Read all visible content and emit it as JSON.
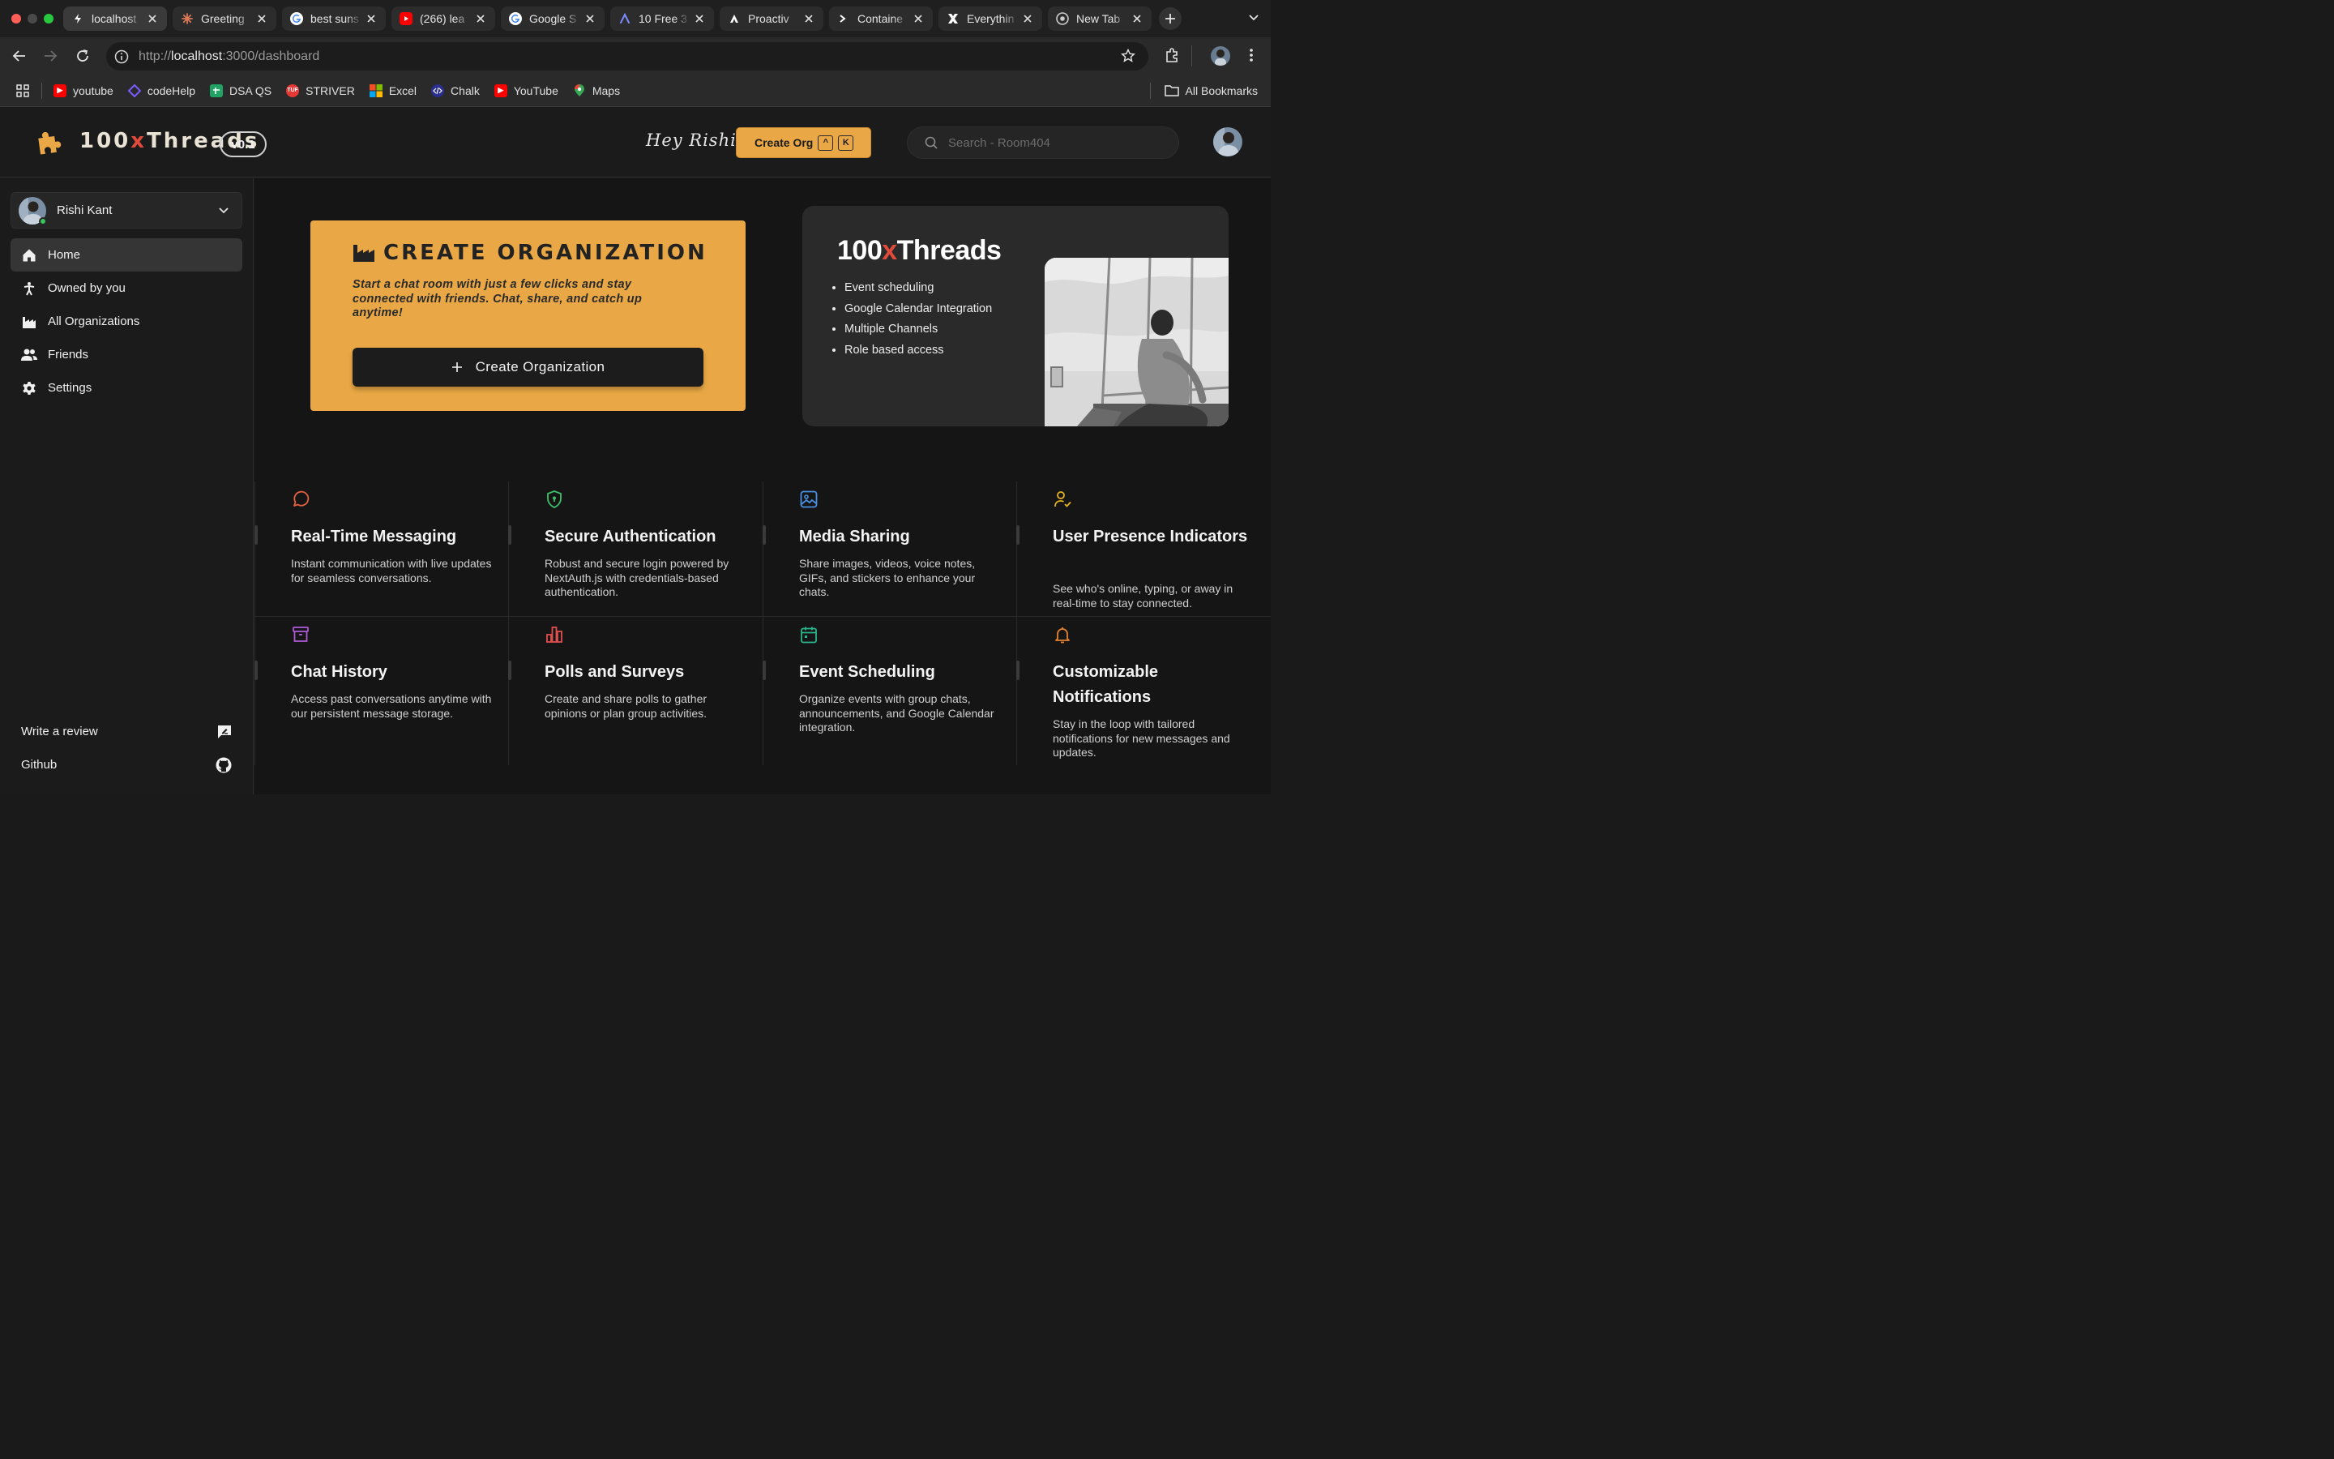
{
  "browser": {
    "tabs": [
      {
        "label": "localhost",
        "icon": "bolt-icon",
        "color": "#1f1f1f"
      },
      {
        "label": "Greeting",
        "icon": "claude-icon",
        "color": "#d97757"
      },
      {
        "label": "best suns",
        "icon": "google-icon",
        "color": "#ffffff"
      },
      {
        "label": "(266) lea",
        "icon": "youtube-icon",
        "color": "#ff0000"
      },
      {
        "label": "Google S",
        "icon": "google-icon",
        "color": "#ffffff"
      },
      {
        "label": "10 Free 3",
        "icon": "arc-icon",
        "color": "#5b6ee1"
      },
      {
        "label": "Proactiv",
        "icon": "vercel-icon",
        "color": "#111111"
      },
      {
        "label": "Containe",
        "icon": "terminal-icon",
        "color": "#111111"
      },
      {
        "label": "Everythin",
        "icon": "x-logo-icon",
        "color": "#222222"
      },
      {
        "label": "New Tab",
        "icon": "chrome-icon",
        "color": "#4a4a4a"
      }
    ],
    "url_scheme": "http://",
    "url_host": "localhost",
    "url_path": ":3000/dashboard",
    "bookmarks": [
      {
        "label": "youtube",
        "icon": "youtube-icon",
        "color": "#ff0000"
      },
      {
        "label": "codeHelp",
        "icon": "codehelp-icon",
        "color": "#7a5cff"
      },
      {
        "label": "DSA QS",
        "icon": "sheets-icon",
        "color": "#21a366"
      },
      {
        "label": "STRIVER",
        "icon": "tuf-icon",
        "color": "#e53935"
      },
      {
        "label": "Excel",
        "icon": "microsoft-icon",
        "color": "#f25022"
      },
      {
        "label": "Chalk",
        "icon": "chalk-icon",
        "color": "#2a2f8f"
      },
      {
        "label": "YouTube",
        "icon": "youtube-icon",
        "color": "#ff0000"
      },
      {
        "label": "Maps",
        "icon": "maps-pin-icon",
        "color": "#34a853"
      }
    ],
    "all_bookmarks_label": "All Bookmarks"
  },
  "header": {
    "brand_prefix": "100",
    "brand_x": "x",
    "brand_suffix": "Threads",
    "version": "v0.1",
    "greeting": "Hey Rishi",
    "create_org_label": "Create Org",
    "shortcut_keys": [
      "^",
      "K"
    ],
    "search_placeholder": "Search - Room404"
  },
  "sidebar": {
    "user_name": "Rishi Kant",
    "items": [
      {
        "label": "Home",
        "icon": "home-icon",
        "active": true
      },
      {
        "label": "Owned by you",
        "icon": "person-icon",
        "active": false
      },
      {
        "label": "All Organizations",
        "icon": "factory-icon",
        "active": false
      },
      {
        "label": "Friends",
        "icon": "people-icon",
        "active": false
      },
      {
        "label": "Settings",
        "icon": "gear-icon",
        "active": false
      }
    ],
    "write_review": "Write a review",
    "github": "Github"
  },
  "org_card": {
    "title": "CREATE ORGANIZATION",
    "description": "Start a chat room with just a few clicks and stay connected with friends. Chat, share, and catch up anytime!",
    "button_label": "Create Organization",
    "background": "#e9a845"
  },
  "promo": {
    "title_prefix": "100",
    "title_x": "x",
    "title_suffix": "Threads",
    "features": [
      "Event scheduling",
      "Google Calendar Integration",
      "Multiple Channels",
      "Role based access"
    ]
  },
  "features": [
    {
      "title": "Real-Time Messaging",
      "desc": "Instant communication with live updates for seamless conversations.",
      "icon": "chat-bubble-icon",
      "color": "#e5603f"
    },
    {
      "title": "Secure Authentication",
      "desc": "Robust and secure login powered by NextAuth.js with credentials-based authentication.",
      "icon": "shield-icon",
      "color": "#3fbf6a"
    },
    {
      "title": "Media Sharing",
      "desc": "Share images, videos, voice notes, GIFs, and stickers to enhance your chats.",
      "icon": "image-icon",
      "color": "#4a90e2"
    },
    {
      "title": "User Presence Indicators",
      "desc": "See who's online, typing, or away in real-time to stay connected.",
      "icon": "user-check-icon",
      "color": "#e6b422"
    },
    {
      "title": "Chat History",
      "desc": "Access past conversations anytime with our persistent message storage.",
      "icon": "archive-icon",
      "color": "#b05ad8"
    },
    {
      "title": "Polls and Surveys",
      "desc": "Create and share polls to gather opinions or plan group activities.",
      "icon": "bar-chart-icon",
      "color": "#e04f4f"
    },
    {
      "title": "Event Scheduling",
      "desc": "Organize events with group chats, announcements, and Google Calendar integration.",
      "icon": "calendar-icon",
      "color": "#2bb58a"
    },
    {
      "title": "Customizable Notifications",
      "desc": "Stay in the loop with tailored notifications for new messages and updates.",
      "icon": "bell-icon",
      "color": "#e5822f"
    }
  ]
}
